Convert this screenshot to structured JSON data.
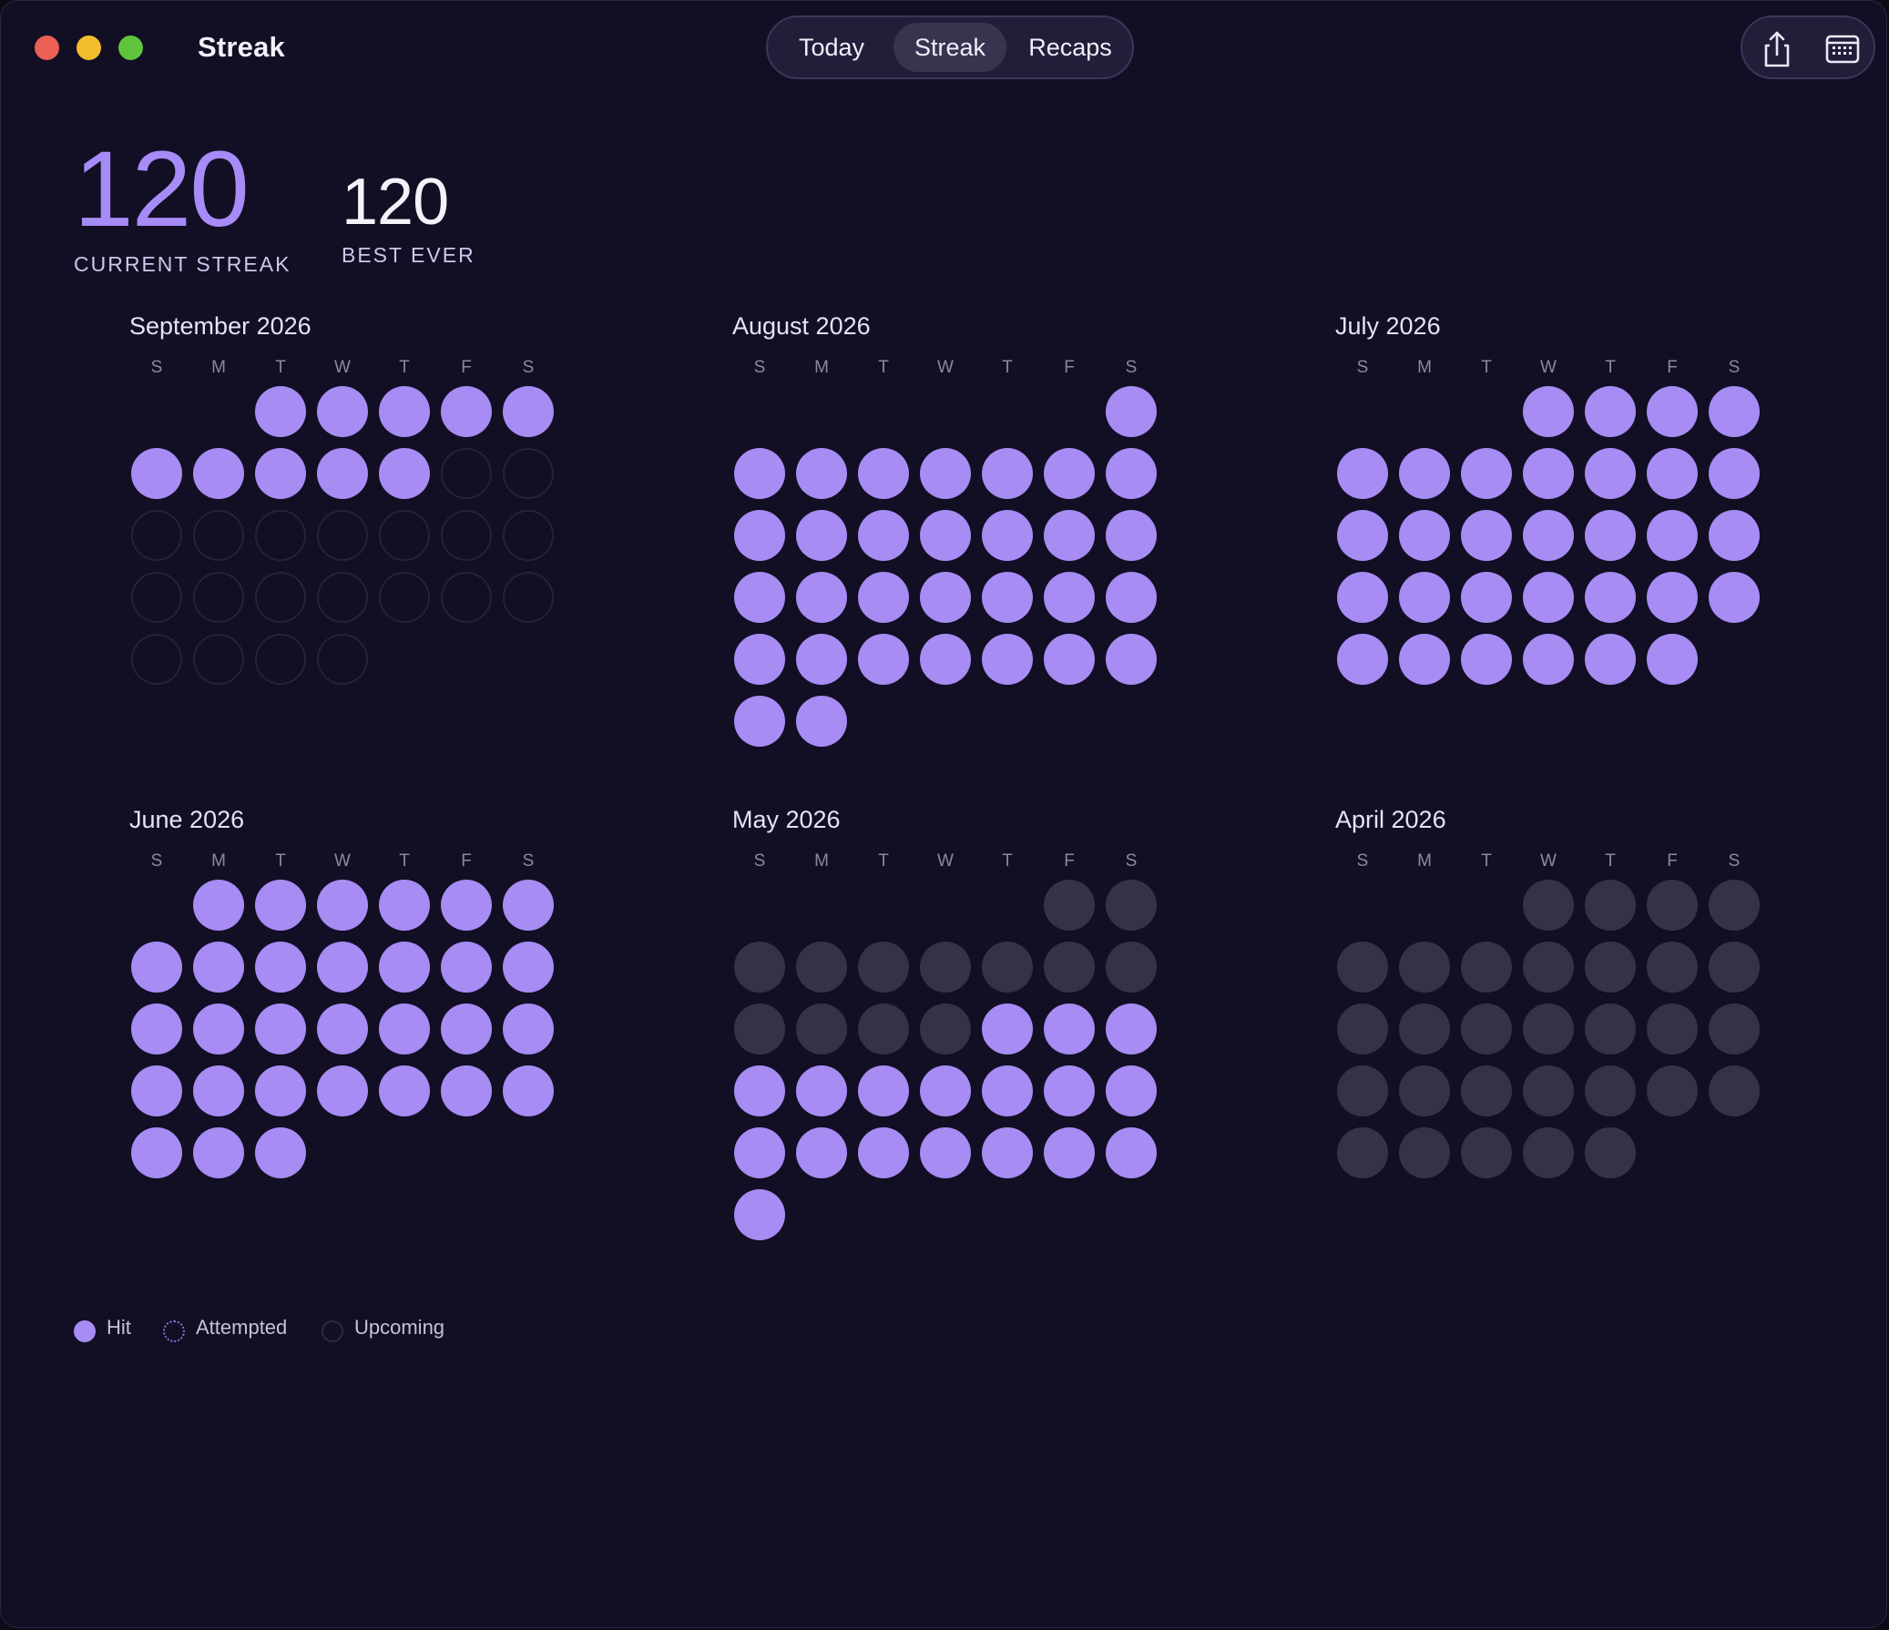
{
  "window": {
    "app_title": "Streak"
  },
  "nav": {
    "tabs": [
      "Today",
      "Streak",
      "Recaps"
    ],
    "selected": "Streak"
  },
  "toolbar": {
    "icons": [
      "share-icon",
      "calendar-icon"
    ]
  },
  "stats": {
    "current_streak": "120",
    "current_label": "CURRENT STREAK",
    "best_ever": "120",
    "best_label": "BEST EVER"
  },
  "colors": {
    "accent": "#a68cf3",
    "past": "#363147",
    "background": "#120e24"
  },
  "weekdays": [
    "S",
    "M",
    "T",
    "W",
    "T",
    "F",
    "S"
  ],
  "months": [
    {
      "title": "September 2026",
      "first_weekday": 2,
      "days": 30,
      "hit_days": [
        1,
        2,
        3,
        4,
        5,
        6,
        7,
        8,
        9,
        10
      ],
      "past_days": []
    },
    {
      "title": "August 2026",
      "first_weekday": 6,
      "days": 31,
      "hit_days": "all",
      "past_days": []
    },
    {
      "title": "July 2026",
      "first_weekday": 3,
      "days": 31,
      "hit_days": "all",
      "past_days": []
    },
    {
      "title": "June 2026",
      "first_weekday": 1,
      "days": 30,
      "hit_days": "all",
      "past_days": []
    },
    {
      "title": "May 2026",
      "first_weekday": 5,
      "days": 31,
      "hit_days": [
        14,
        15,
        16,
        17,
        18,
        19,
        20,
        21,
        22,
        23,
        24,
        25,
        26,
        27,
        28,
        29,
        30,
        31
      ],
      "past_days": [
        1,
        2,
        3,
        4,
        5,
        6,
        7,
        8,
        9,
        10,
        11,
        12,
        13
      ]
    },
    {
      "title": "April 2026",
      "first_weekday": 3,
      "days": 30,
      "hit_days": [],
      "past_days": "all"
    }
  ],
  "legend": [
    "Hit",
    "Attempted",
    "Upcoming"
  ]
}
